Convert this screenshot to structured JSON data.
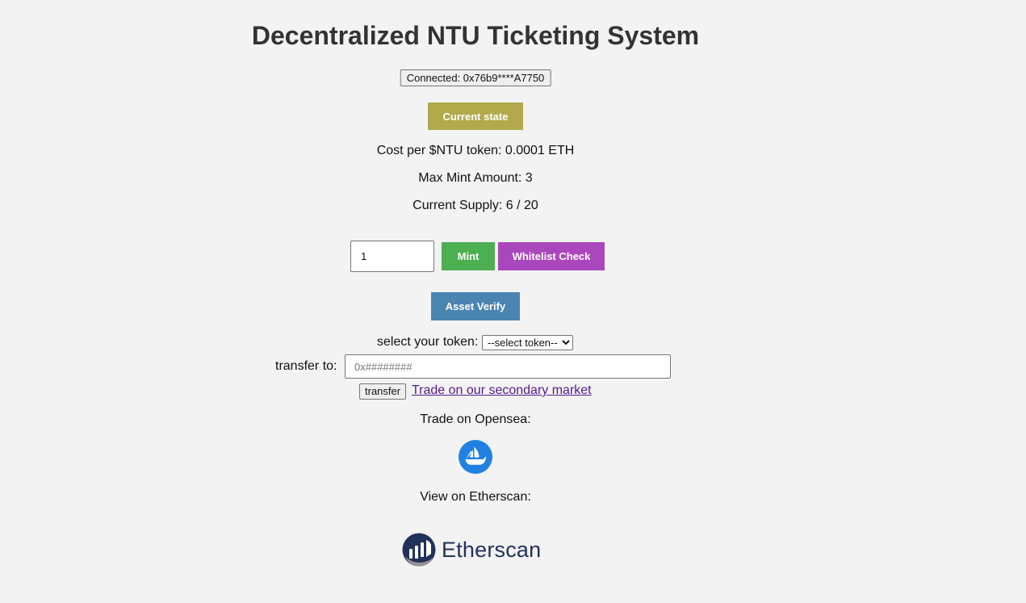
{
  "header": {
    "title": "Decentralized NTU Ticketing System",
    "connected_label": "Connected: 0x76b9****A7750"
  },
  "state": {
    "button_label": "Current state",
    "cost": "Cost per $NTU token: 0.0001 ETH",
    "max_mint": "Max Mint Amount: 3",
    "supply": "Current Supply: 6 / 20"
  },
  "mint": {
    "quantity_value": "1",
    "mint_label": "Mint",
    "whitelist_label": "Whitelist Check"
  },
  "verify": {
    "label": "Asset Verify"
  },
  "transfer": {
    "select_label": "select your token:",
    "select_value": "--select token--",
    "to_label": "transfer to:",
    "address_placeholder": "0x########",
    "button_label": "transfer",
    "market_link": "Trade on our secondary market"
  },
  "links": {
    "opensea_label": "Trade on Opensea:",
    "opensea_icon": "opensea-boat-logo",
    "etherscan_label": "View on Etherscan:",
    "etherscan_logo_text": "Etherscan"
  },
  "colors": {
    "state_button": "#b2a94a",
    "mint_button": "#4caf50",
    "whitelist_button": "#ab47bc",
    "verify_button": "#4a84b0",
    "opensea_blue": "#2081e2",
    "etherscan_navy": "#21325b"
  }
}
